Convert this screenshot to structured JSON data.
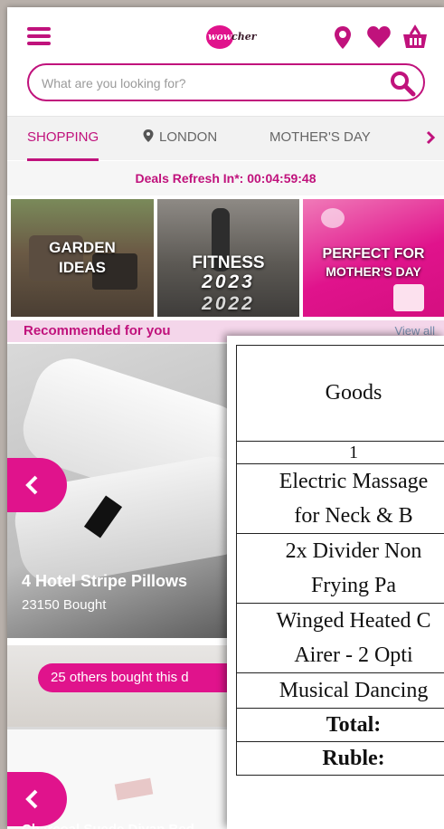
{
  "header": {
    "logo_text": "wow",
    "logo_text2": "cher",
    "search_placeholder": "What are you looking for?"
  },
  "tabs": [
    {
      "label": "SHOPPING",
      "active": true
    },
    {
      "label": "LONDON",
      "icon": "location-pin-icon"
    },
    {
      "label": "MOTHER'S DAY"
    }
  ],
  "deals": {
    "label": "Deals Refresh In*: ",
    "timer": "00:04:59:48"
  },
  "tiles": [
    {
      "line1": "GARDEN",
      "line2": "IDEAS"
    },
    {
      "line1": "FITNESS",
      "line2": "2023",
      "line3": "2022"
    },
    {
      "line1": "PERFECT FOR",
      "line2": "MOTHER'S DAY"
    }
  ],
  "recommended": {
    "title": "Recommended for you",
    "view_all": "View all"
  },
  "cards": [
    {
      "title": "4 Hotel Stripe Pillows",
      "sub": "23150 Bought"
    },
    {
      "badge": "25 others bought this d",
      "title": "Charcoal Suede Divan Bed"
    }
  ],
  "goods_table": {
    "header": "Goods",
    "index": "1",
    "rows": [
      {
        "line1": "Electric  Massage",
        "line2": "for Neck & B"
      },
      {
        "line1": "2x Divider  Non",
        "line2": "Frying Pa"
      },
      {
        "line1": "Winged Heated C",
        "line2": "Airer - 2 Opti"
      },
      {
        "line1": "Musical Dancing"
      }
    ],
    "total_label": "Total:",
    "ruble_label": "Ruble:"
  },
  "colors": {
    "brand": "#c0127c",
    "accent": "#e0138c"
  }
}
